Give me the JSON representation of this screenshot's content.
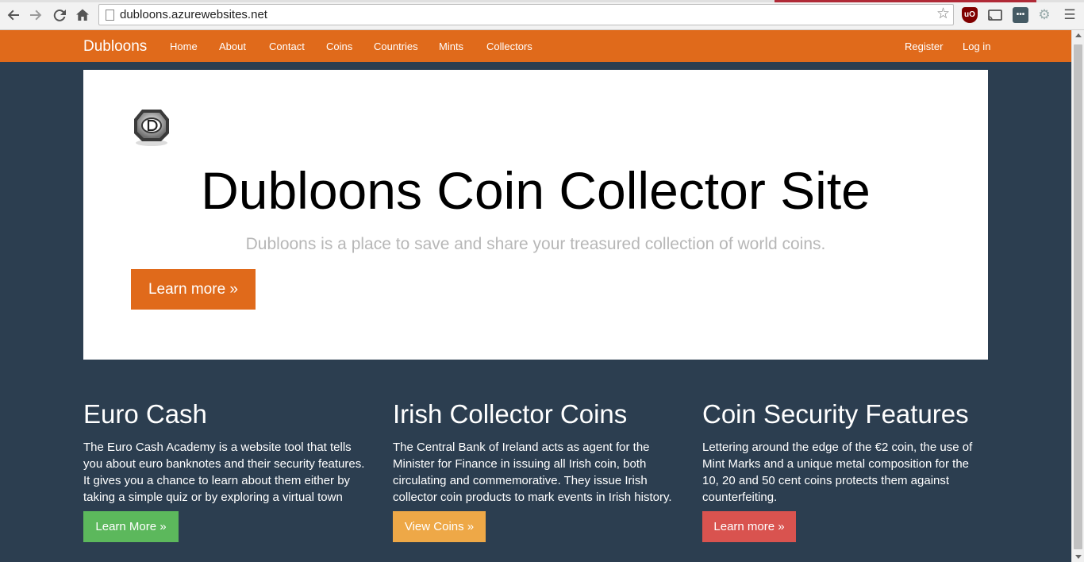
{
  "browser": {
    "url": "dubloons.azurewebsites.net",
    "icons": [
      "back-icon",
      "forward-icon",
      "reload-icon",
      "home-icon",
      "bookmark-star-icon",
      "ublock-icon",
      "cast-icon",
      "more-dots-icon",
      "gear-icon",
      "menu-icon"
    ],
    "ublock_label": "uO"
  },
  "navbar": {
    "brand": "Dubloons",
    "links": [
      "Home",
      "About",
      "Contact",
      "Coins",
      "Countries",
      "Mints",
      "Collectors"
    ],
    "right_links": [
      "Register",
      "Log in"
    ],
    "color": "#e06a1b"
  },
  "jumbotron": {
    "title": "Dubloons Coin Collector Site",
    "subtitle": "Dubloons is a place to save and share your treasured collection of world coins.",
    "button": "Learn more »"
  },
  "features": [
    {
      "heading": "Euro Cash",
      "text": "The Euro Cash Academy is a website tool that tells you about euro banknotes and their security features. It gives you a chance to learn about them either by taking a simple quiz or by exploring a virtual town square.",
      "button": "Learn More »",
      "button_color": "#5cb85c"
    },
    {
      "heading": "Irish Collector Coins",
      "text": "The Central Bank of Ireland acts as agent for the Minister for Finance in issuing all Irish coin, both circulating and commemorative. They issue Irish collector coin products to mark events in Irish history.",
      "button": "View Coins »",
      "button_color": "#eea847"
    },
    {
      "heading": "Coin Security Features",
      "text": "Lettering around the edge of the €2 coin, the use of Mint Marks and a unique metal composition for the 10, 20 and 50 cent coins protects them against counterfeiting.",
      "button": "Learn more »",
      "button_color": "#d9534f"
    }
  ],
  "colors": {
    "page_background": "#2c3e50",
    "jumbotron_background": "#ffffff"
  }
}
